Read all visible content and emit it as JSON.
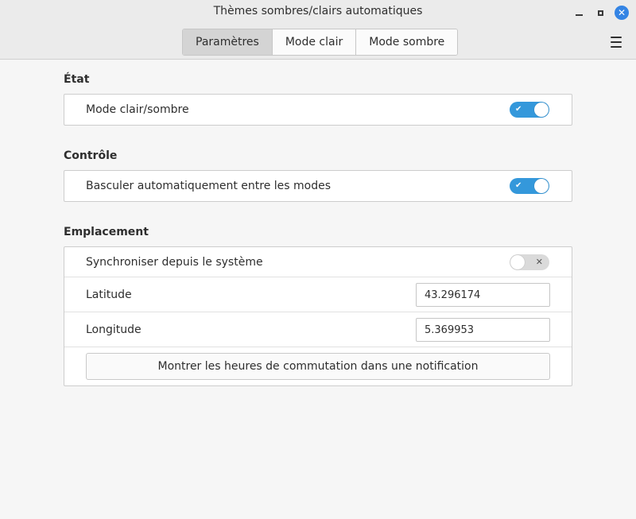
{
  "window": {
    "title": "Thèmes sombres/clairs automatiques",
    "accent_color": "#3498db",
    "close_button_color": "#3484e4"
  },
  "tabs": [
    {
      "label": "Paramètres",
      "active": true
    },
    {
      "label": "Mode clair",
      "active": false
    },
    {
      "label": "Mode sombre",
      "active": false
    }
  ],
  "sections": {
    "etat": {
      "title": "État",
      "mode_toggle_label": "Mode clair/sombre",
      "mode_toggle_on": true
    },
    "controle": {
      "title": "Contrôle",
      "auto_switch_label": "Basculer automatiquement entre les modes",
      "auto_switch_on": true
    },
    "emplacement": {
      "title": "Emplacement",
      "sync_label": "Synchroniser depuis le système",
      "sync_on": false,
      "latitude_label": "Latitude",
      "latitude_value": "43.296174",
      "longitude_label": "Longitude",
      "longitude_value": "5.369953",
      "notification_button_label": "Montrer les heures de commutation dans une notification"
    }
  },
  "icons": {
    "minimize": "minimize-icon",
    "maximize": "maximize-icon",
    "close": "close-icon",
    "menu": "hamburger-menu-icon",
    "switch_on_glyph": "✔",
    "switch_off_glyph": "✕"
  }
}
